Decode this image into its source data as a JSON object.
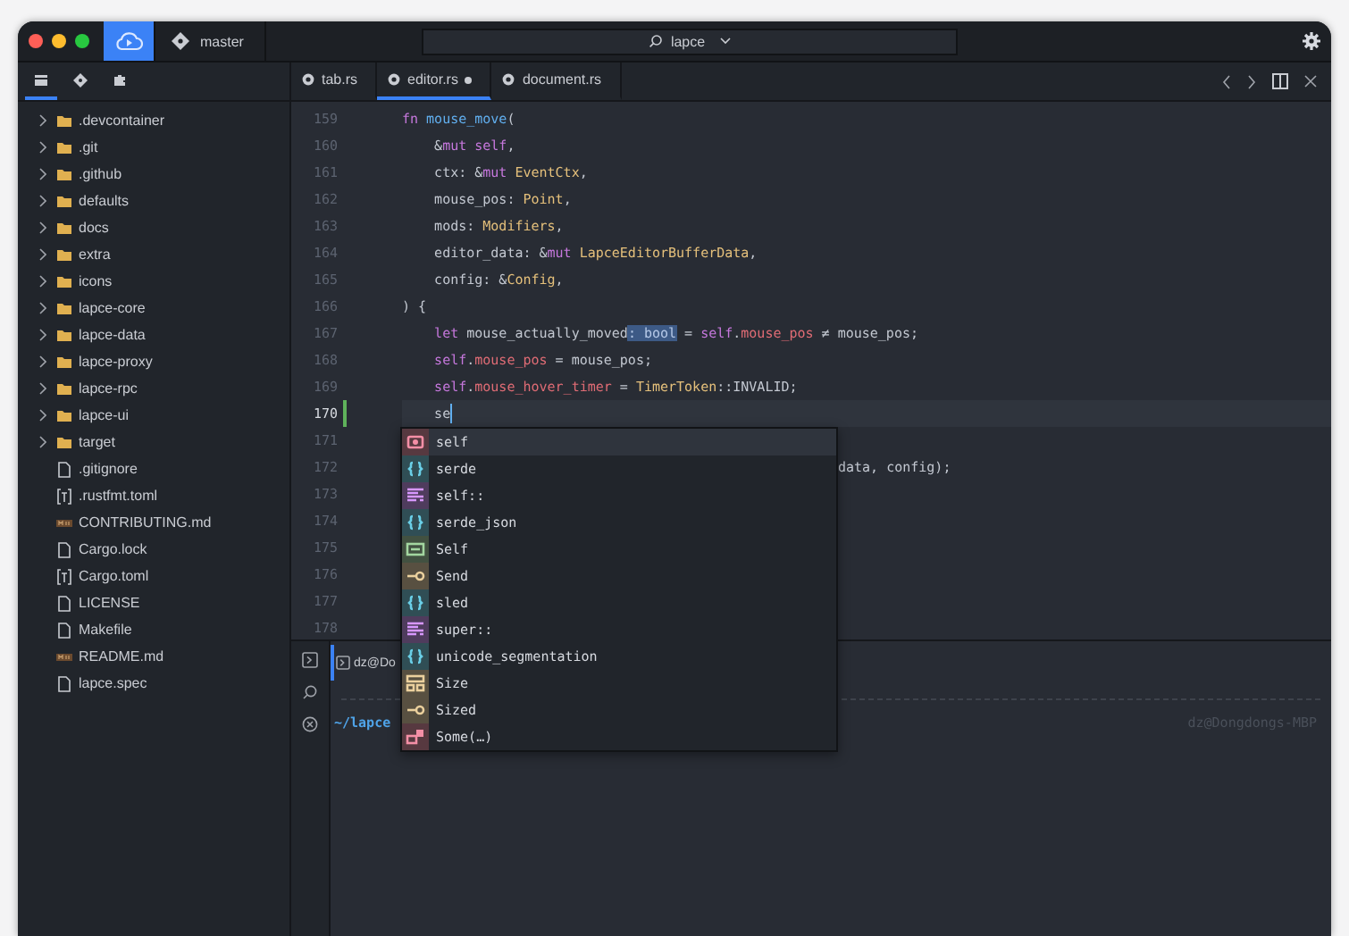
{
  "titlebar": {
    "branch": "master",
    "search": {
      "value": "lapce"
    }
  },
  "sidebar_tabs": [
    {
      "kind": "files",
      "selected": true
    },
    {
      "kind": "git",
      "selected": false
    },
    {
      "kind": "plugins",
      "selected": false
    }
  ],
  "explorer": [
    {
      "label": ".devcontainer",
      "kind": "folder"
    },
    {
      "label": ".git",
      "kind": "folder"
    },
    {
      "label": ".github",
      "kind": "folder"
    },
    {
      "label": "defaults",
      "kind": "folder"
    },
    {
      "label": "docs",
      "kind": "folder"
    },
    {
      "label": "extra",
      "kind": "folder"
    },
    {
      "label": "icons",
      "kind": "folder"
    },
    {
      "label": "lapce-core",
      "kind": "folder"
    },
    {
      "label": "lapce-data",
      "kind": "folder"
    },
    {
      "label": "lapce-proxy",
      "kind": "folder"
    },
    {
      "label": "lapce-rpc",
      "kind": "folder"
    },
    {
      "label": "lapce-ui",
      "kind": "folder"
    },
    {
      "label": "target",
      "kind": "folder"
    },
    {
      "label": ".gitignore",
      "kind": "file"
    },
    {
      "label": ".rustfmt.toml",
      "kind": "toml"
    },
    {
      "label": "CONTRIBUTING.md",
      "kind": "markdown"
    },
    {
      "label": "Cargo.lock",
      "kind": "file"
    },
    {
      "label": "Cargo.toml",
      "kind": "toml"
    },
    {
      "label": "LICENSE",
      "kind": "file"
    },
    {
      "label": "Makefile",
      "kind": "file"
    },
    {
      "label": "README.md",
      "kind": "markdown"
    },
    {
      "label": "lapce.spec",
      "kind": "file"
    }
  ],
  "editor_tabs": [
    {
      "label": "tab.rs",
      "selected": false,
      "modified": false
    },
    {
      "label": "editor.rs",
      "selected": true,
      "modified": true
    },
    {
      "label": "document.rs",
      "selected": false,
      "modified": false
    }
  ],
  "code_lines": [
    {
      "number": "159",
      "current": false,
      "changed": false,
      "kind": "full",
      "tokens": [
        {
          "kind": "kw",
          "text": "fn "
        },
        {
          "kind": "fn",
          "text": "mouse_move"
        },
        {
          "kind": "plain",
          "text": "("
        }
      ]
    },
    {
      "number": "160",
      "current": false,
      "changed": false,
      "kind": "full",
      "tokens": [
        {
          "kind": "plain",
          "text": "    &"
        },
        {
          "kind": "kw",
          "text": "mut self"
        },
        {
          "kind": "plain",
          "text": ","
        }
      ]
    },
    {
      "number": "161",
      "current": false,
      "changed": false,
      "kind": "full",
      "tokens": [
        {
          "kind": "plain",
          "text": "    ctx: &"
        },
        {
          "kind": "kw",
          "text": "mut "
        },
        {
          "kind": "type",
          "text": "EventCtx"
        },
        {
          "kind": "plain",
          "text": ","
        }
      ]
    },
    {
      "number": "162",
      "current": false,
      "changed": false,
      "kind": "full",
      "tokens": [
        {
          "kind": "plain",
          "text": "    mouse_pos: "
        },
        {
          "kind": "type",
          "text": "Point"
        },
        {
          "kind": "plain",
          "text": ","
        }
      ]
    },
    {
      "number": "163",
      "current": false,
      "changed": false,
      "kind": "full",
      "tokens": [
        {
          "kind": "plain",
          "text": "    mods: "
        },
        {
          "kind": "type",
          "text": "Modifiers"
        },
        {
          "kind": "plain",
          "text": ","
        }
      ]
    },
    {
      "number": "164",
      "current": false,
      "changed": false,
      "kind": "full",
      "tokens": [
        {
          "kind": "plain",
          "text": "    editor_data: &"
        },
        {
          "kind": "kw",
          "text": "mut "
        },
        {
          "kind": "type",
          "text": "LapceEditorBufferData"
        },
        {
          "kind": "plain",
          "text": ","
        }
      ]
    },
    {
      "number": "165",
      "current": false,
      "changed": false,
      "kind": "full",
      "tokens": [
        {
          "kind": "plain",
          "text": "    config: &"
        },
        {
          "kind": "type",
          "text": "Config"
        },
        {
          "kind": "plain",
          "text": ","
        }
      ]
    },
    {
      "number": "166",
      "current": false,
      "changed": false,
      "kind": "full",
      "tokens": [
        {
          "kind": "plain",
          "text": ") {"
        }
      ]
    },
    {
      "number": "167",
      "current": false,
      "changed": false,
      "kind": "full",
      "tokens": [
        {
          "kind": "kw",
          "text": "    let "
        },
        {
          "kind": "plain",
          "text": "mouse_actually_moved"
        },
        {
          "kind": "hint",
          "text": ": bool"
        },
        {
          "kind": "plain",
          "text": " = "
        },
        {
          "kind": "kw",
          "text": "self"
        },
        {
          "kind": "plain",
          "text": "."
        },
        {
          "kind": "field",
          "text": "mouse_pos"
        },
        {
          "kind": "plain",
          "text": " ≠ mouse_pos;"
        }
      ]
    },
    {
      "number": "168",
      "current": false,
      "changed": false,
      "kind": "full",
      "tokens": [
        {
          "kind": "kw",
          "text": "    self"
        },
        {
          "kind": "plain",
          "text": "."
        },
        {
          "kind": "field",
          "text": "mouse_pos"
        },
        {
          "kind": "plain",
          "text": " = mouse_pos;"
        }
      ]
    },
    {
      "number": "169",
      "current": false,
      "changed": false,
      "kind": "full",
      "tokens": [
        {
          "kind": "kw",
          "text": "    self"
        },
        {
          "kind": "plain",
          "text": "."
        },
        {
          "kind": "field",
          "text": "mouse_hover_timer"
        },
        {
          "kind": "plain",
          "text": " = "
        },
        {
          "kind": "type",
          "text": "TimerToken"
        },
        {
          "kind": "plain",
          "text": "::INVALID;"
        }
      ]
    },
    {
      "number": "170",
      "current": true,
      "changed": true,
      "kind": "full",
      "tokens": [
        {
          "kind": "plain",
          "text": "    se"
        }
      ]
    },
    {
      "number": "171",
      "current": false,
      "changed": false,
      "kind": "full"
    },
    {
      "number": "172",
      "current": false,
      "changed": false,
      "kind": "tail",
      "tokens": [
        {
          "kind": "plain",
          "text": "data, config);"
        }
      ]
    },
    {
      "number": "173",
      "current": false,
      "changed": false,
      "kind": "full"
    },
    {
      "number": "174",
      "current": false,
      "changed": false,
      "kind": "full"
    },
    {
      "number": "175",
      "current": false,
      "changed": false,
      "kind": "full"
    },
    {
      "number": "176",
      "current": false,
      "changed": false,
      "kind": "full"
    },
    {
      "number": "177",
      "current": false,
      "changed": false,
      "kind": "full"
    },
    {
      "number": "178",
      "current": false,
      "changed": false,
      "kind": "full"
    }
  ],
  "completion": [
    {
      "label": "self",
      "kind": "keyword",
      "color": "#573940",
      "selected": true
    },
    {
      "label": "serde",
      "kind": "module",
      "color": "#304e55",
      "selected": false
    },
    {
      "label": "self::",
      "kind": "snippet",
      "color": "#4f3c5d",
      "selected": false
    },
    {
      "label": "serde_json",
      "kind": "module",
      "color": "#304e55",
      "selected": false
    },
    {
      "label": "Self",
      "kind": "struct",
      "color": "#425141",
      "selected": false
    },
    {
      "label": "Send",
      "kind": "trait",
      "color": "#585041",
      "selected": false
    },
    {
      "label": "sled",
      "kind": "module",
      "color": "#304e55",
      "selected": false
    },
    {
      "label": "super::",
      "kind": "snippet",
      "color": "#4f3c5d",
      "selected": false
    },
    {
      "label": "unicode_segmentation",
      "kind": "module",
      "color": "#304e55",
      "selected": false
    },
    {
      "label": "Size",
      "kind": "enum",
      "color": "#585041",
      "selected": false
    },
    {
      "label": "Sized",
      "kind": "trait",
      "color": "#585041",
      "selected": false
    },
    {
      "label": "Some(…)",
      "kind": "variant",
      "color": "#573940",
      "selected": false
    }
  ],
  "panel": {
    "terminal_tab": "dz@Do",
    "cwd": "~/lapce",
    "host": "dz@Dongdongs-MBP"
  }
}
